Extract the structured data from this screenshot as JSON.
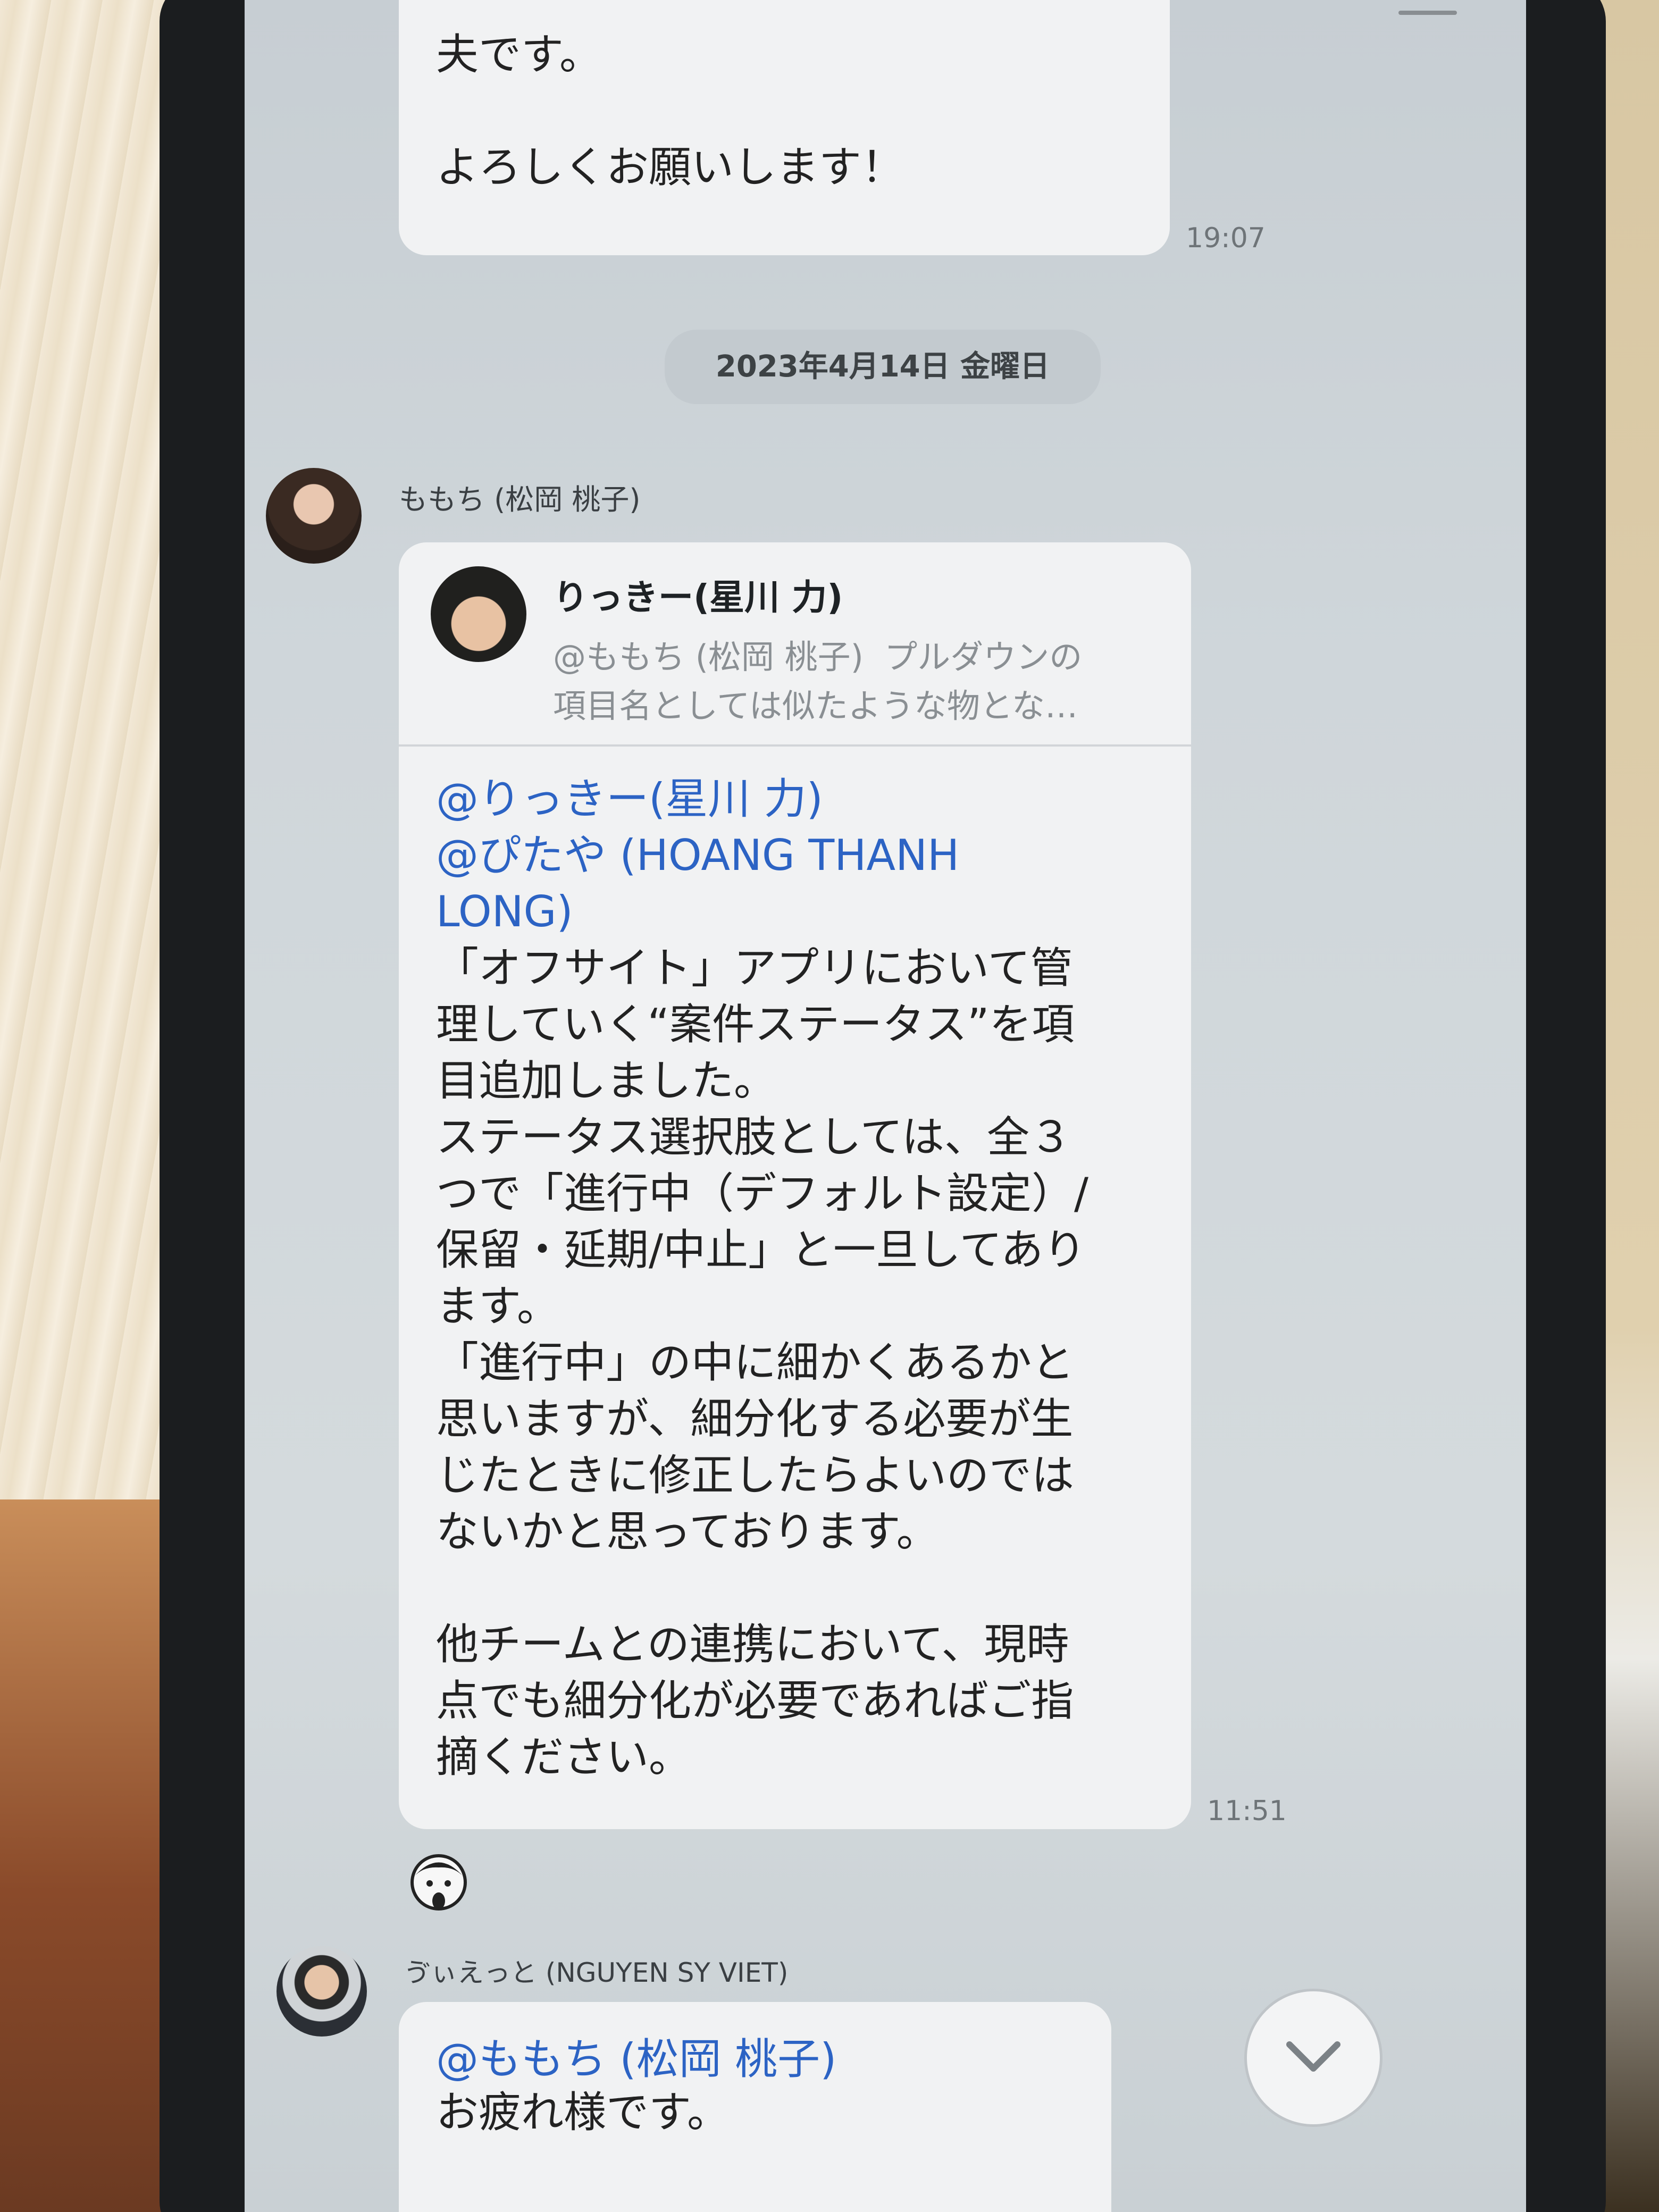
{
  "chat": {
    "prev_message": {
      "text": "夫です。\n\nよろしくお願いします！",
      "time": "19:07"
    },
    "date_separator": "2023年4月14日 金曜日",
    "message1": {
      "sender": "ももち (松岡 桃子)",
      "quote": {
        "author": "りっきー(星川 力)",
        "preview": "@ももち (松岡 桃子)  プルダウンの\n項目名としては似たような物とな…"
      },
      "mention1": "@りっきー(星川 力)",
      "mention2": "@ぴたや (HOANG THANH\nLONG)",
      "body": "「オフサイト」アプリにおいて管\n理していく“案件ステータス”を項\n目追加しました。\nステータス選択肢としては、全３\nつで「進行中（デフォルト設定）/\n保留・延期/中止」と一旦してあり\nます。\n「進行中」の中に細かくあるかと\n思いますが、細分化する必要が生\nじたときに修正したらよいのでは\nないかと思っております。\n\n他チームとの連携において、現時\n点でも細分化が必要であればご指\n摘ください。",
      "time": "11:51"
    },
    "message2": {
      "sender": "ゔぃえっと (NGUYEN SY VIET)",
      "mention": "@ももち (松岡 桃子)",
      "body": "お疲れ様です。"
    }
  },
  "icons": {
    "reaction": "reaction-face-icon",
    "scroll_down": "chevron-down-icon"
  },
  "colors": {
    "mention": "#2c63c4",
    "bubble": "#f1f2f3",
    "chat_background": "#cfd6da"
  }
}
